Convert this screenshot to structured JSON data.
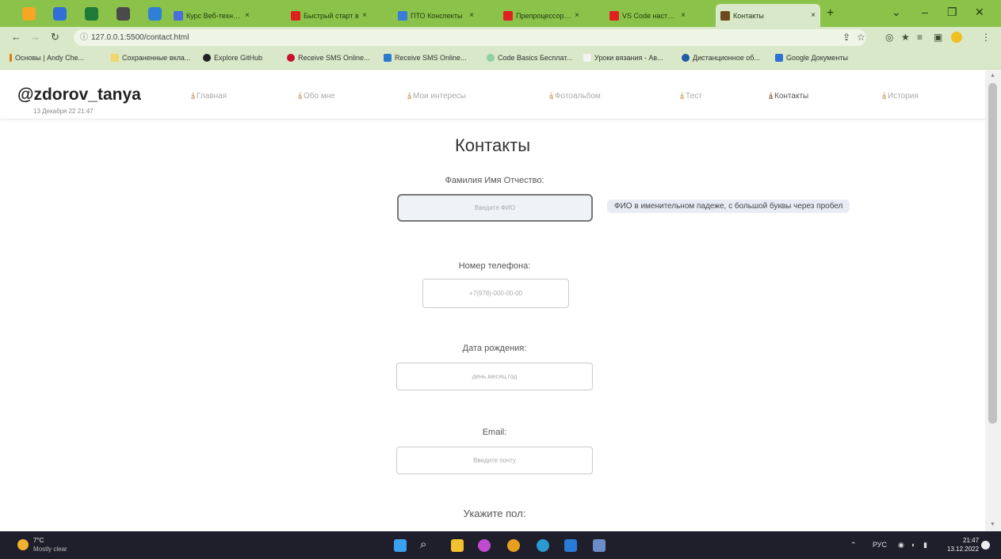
{
  "browser": {
    "tabs": [
      {
        "title": "Курс Веб-техноло",
        "color": "#4a6fd8"
      },
      {
        "title": "Быстрый старт в",
        "color": "#e02020"
      },
      {
        "title": "ПТО Конспекты",
        "color": "#3a7bd5"
      },
      {
        "title": "Препроцессор Sc",
        "color": "#e02020"
      },
      {
        "title": "VS Code настройк",
        "color": "#e02020"
      },
      {
        "title": "Контакты",
        "color": "#6b4a1e"
      }
    ],
    "tab_close": "×",
    "new_tab": "+",
    "url": "127.0.0.1:5500/contact.html",
    "bookmarks": [
      "Основы | Andy Che...",
      "Сохраненные вкла...",
      "Explore GitHub",
      "Receive SMS Online...",
      "Receive SMS Online...",
      "Code Basics Бесплат...",
      "Уроки вязания - Ав...",
      "Дистанционное об...",
      "Google Документы"
    ]
  },
  "site": {
    "logo": "@zdorov_tanya",
    "date": "13 Декабря 22 21:47",
    "nav": [
      {
        "label": "Главная",
        "active": false
      },
      {
        "label": "Обо мне",
        "active": false
      },
      {
        "label": "Мои интересы",
        "active": false
      },
      {
        "label": "Фотоальбом",
        "active": false
      },
      {
        "label": "Тест",
        "active": false
      },
      {
        "label": "Контакты",
        "active": true
      },
      {
        "label": "История",
        "active": false
      }
    ]
  },
  "form": {
    "heading": "Контакты",
    "fio_label": "Фамилия Имя Отчество:",
    "fio_placeholder": "Введите ФИО",
    "fio_tooltip": "ФИО в именительном падеже, с большой буквы через пробел",
    "phone_label": "Номер телефона:",
    "phone_placeholder": "+7(978)-000-00-00",
    "birth_label": "Дата рождения:",
    "birth_placeholder": "день.месяц.год",
    "email_label": "Email:",
    "email_placeholder": "Введите почту",
    "gender_label": "Укажите пол:"
  },
  "taskbar": {
    "temp": "7°C",
    "weather": "Mostly clear",
    "lang": "РУС",
    "time": "21:47",
    "date": "13.12.2022"
  },
  "colors": {
    "chrome_green": "#8bc34a",
    "chrome_light": "#d9e8c8",
    "taskbar": "#1f1f2c",
    "tooltip_bg": "#e8edf5"
  }
}
